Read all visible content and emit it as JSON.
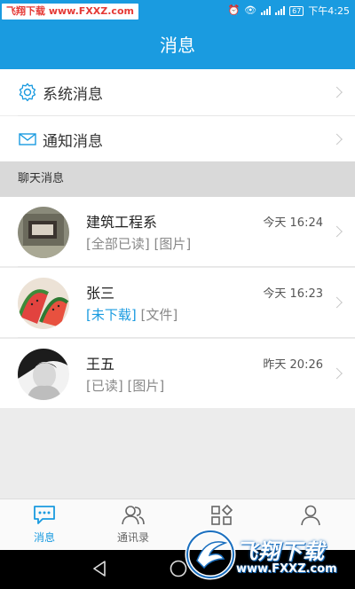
{
  "status_bar": {
    "watermark_part1": "飞翔下载",
    "watermark_part2": "www.FXXZ.com",
    "battery": "67",
    "time": "下午4:25"
  },
  "header": {
    "title": "消息"
  },
  "system_rows": [
    {
      "label": "系统消息",
      "icon": "gear-icon"
    },
    {
      "label": "通知消息",
      "icon": "envelope-icon"
    }
  ],
  "section": {
    "title": "聊天消息"
  },
  "chats": [
    {
      "name": "建筑工程系",
      "time": "今天 16:24",
      "status": "",
      "detail": "[全部已读] [图片]",
      "avatar": "building-photo"
    },
    {
      "name": "张三",
      "time": "今天 16:23",
      "status": "[未下载]",
      "detail": " [文件]",
      "avatar": "watermelon-photo"
    },
    {
      "name": "王五",
      "time": "昨天 20:26",
      "status": "",
      "detail": "[已读] [图片]",
      "avatar": "portrait-photo"
    }
  ],
  "tabs": [
    {
      "label": "消息",
      "icon": "chat-bubble-icon",
      "active": true
    },
    {
      "label": "通讯录",
      "icon": "contacts-icon",
      "active": false
    },
    {
      "label": "",
      "icon": "apps-grid-icon",
      "active": false
    },
    {
      "label": "",
      "icon": "person-icon",
      "active": false
    }
  ],
  "watermark": {
    "title": "飞翔下载",
    "url": "www.FXXZ.com"
  },
  "colors": {
    "primary": "#1a9be0",
    "section_bg": "#d9d9d9",
    "page_bg": "#ececec"
  }
}
